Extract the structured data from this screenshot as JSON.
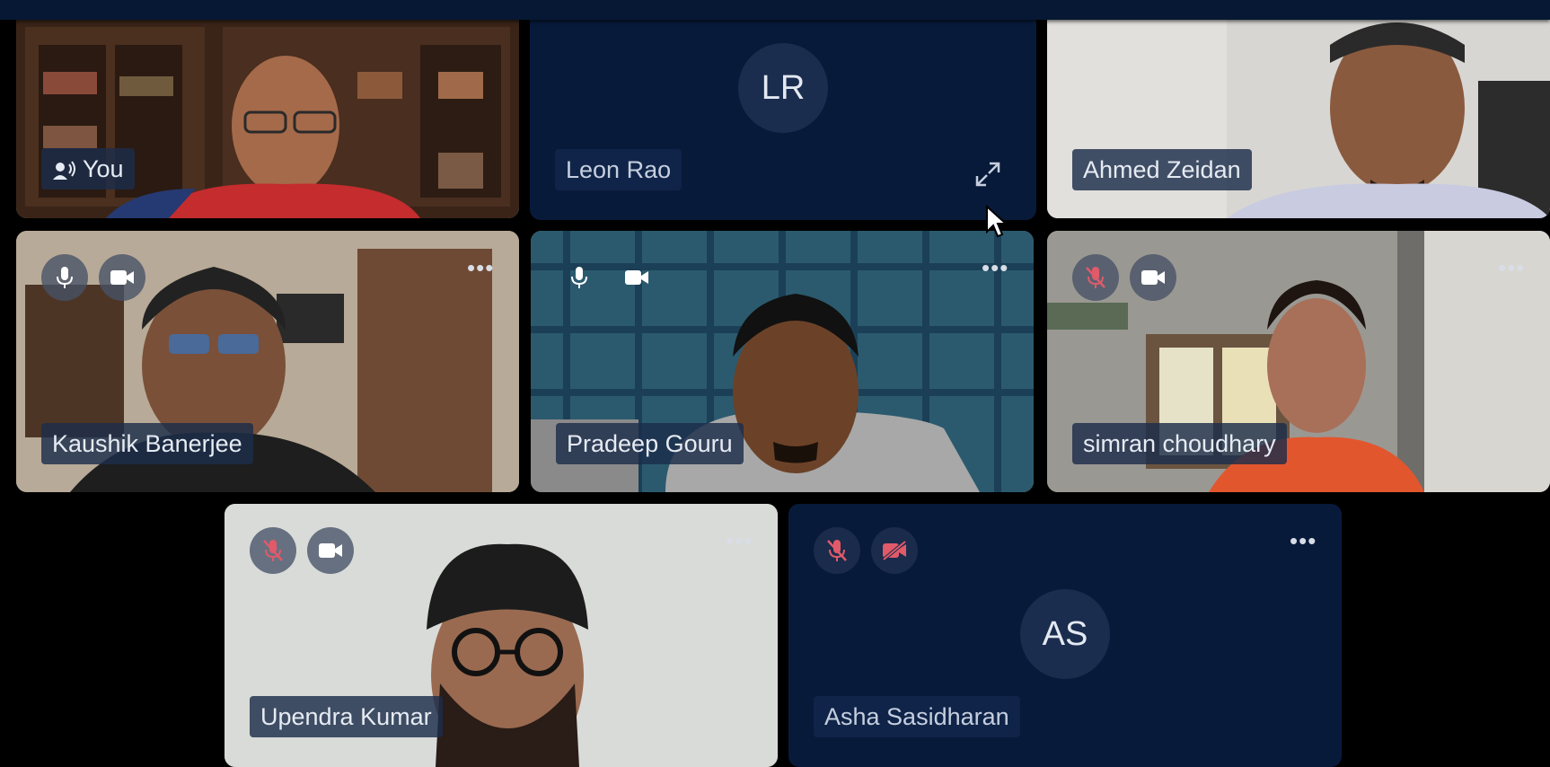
{
  "participants": [
    {
      "name": "You",
      "type": "video"
    },
    {
      "name": "Leon Rao",
      "initials": "LR",
      "type": "avatar"
    },
    {
      "name": "Ahmed Zeidan",
      "type": "video"
    },
    {
      "name": "Kaushik Banerjee",
      "type": "video",
      "mic": "on",
      "camera": "on"
    },
    {
      "name": "Pradeep Gouru",
      "type": "video",
      "mic": "on",
      "camera": "on"
    },
    {
      "name": "simran choudhary",
      "type": "video",
      "mic": "muted",
      "camera": "on"
    },
    {
      "name": "Upendra Kumar",
      "type": "video",
      "mic": "muted",
      "camera": "on"
    },
    {
      "name": "Asha Sasidharan",
      "initials": "AS",
      "type": "avatar",
      "mic": "muted",
      "camera": "off"
    }
  ],
  "more_label": "•••",
  "colors": {
    "tile_bg": "#081a3a",
    "muted": "#e05a6a",
    "background": "#000000"
  }
}
